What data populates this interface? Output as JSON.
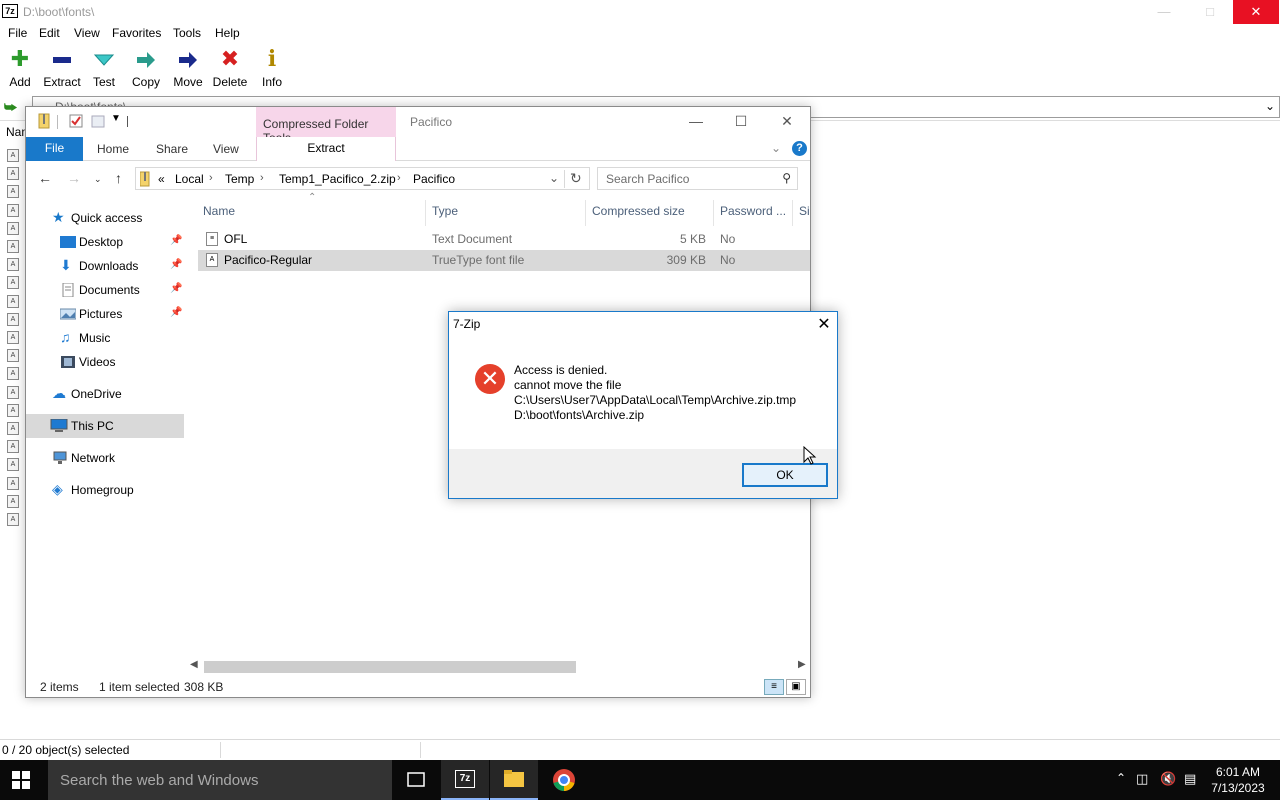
{
  "zip_window": {
    "app_icon_label": "7z",
    "title": "D:\\boot\\fonts\\",
    "menu": [
      "File",
      "Edit",
      "View",
      "Favorites",
      "Tools",
      "Help"
    ],
    "toolbar": [
      "Add",
      "Extract",
      "Test",
      "Copy",
      "Move",
      "Delete",
      "Info"
    ],
    "address": "D:\\boot\\fonts\\",
    "list_header": "Nam",
    "status": "0 / 20 object(s) selected"
  },
  "explorer": {
    "context_tab": "Compressed Folder Tools",
    "title": "Pacifico",
    "ribbon": {
      "file": "File",
      "home": "Home",
      "share": "Share",
      "view": "View",
      "extract": "Extract"
    },
    "breadcrumb": [
      "«",
      "Local",
      "Temp",
      "Temp1_Pacifico_2.zip",
      "Pacifico"
    ],
    "search_placeholder": "Search Pacifico",
    "nav": {
      "quick_access": "Quick access",
      "desktop": "Desktop",
      "downloads": "Downloads",
      "documents": "Documents",
      "pictures": "Pictures",
      "music": "Music",
      "videos": "Videos",
      "onedrive": "OneDrive",
      "this_pc": "This PC",
      "network": "Network",
      "homegroup": "Homegroup"
    },
    "columns": [
      "Name",
      "Type",
      "Compressed size",
      "Password ...",
      "Si"
    ],
    "files": [
      {
        "name": "OFL",
        "type": "Text Document",
        "size": "5 KB",
        "password": "No"
      },
      {
        "name": "Pacifico-Regular",
        "type": "TrueType font file",
        "size": "309 KB",
        "password": "No"
      }
    ],
    "status": {
      "count": "2 items",
      "selected": "1 item selected",
      "size": "308 KB"
    }
  },
  "dialog": {
    "title": "7-Zip",
    "lines": [
      "Access is denied.",
      "cannot move the file",
      "C:\\Users\\User7\\AppData\\Local\\Temp\\Archive.zip.tmp",
      "D:\\boot\\fonts\\Archive.zip"
    ],
    "ok": "OK"
  },
  "taskbar": {
    "search_placeholder": "Search the web and Windows",
    "time": "6:01 AM",
    "date": "7/13/2023",
    "zip_app_label": "7z"
  },
  "colors": {
    "accent": "#1979ca",
    "error": "#e5402b",
    "context_tab": "#f7d6ea",
    "close": "#e81123"
  }
}
